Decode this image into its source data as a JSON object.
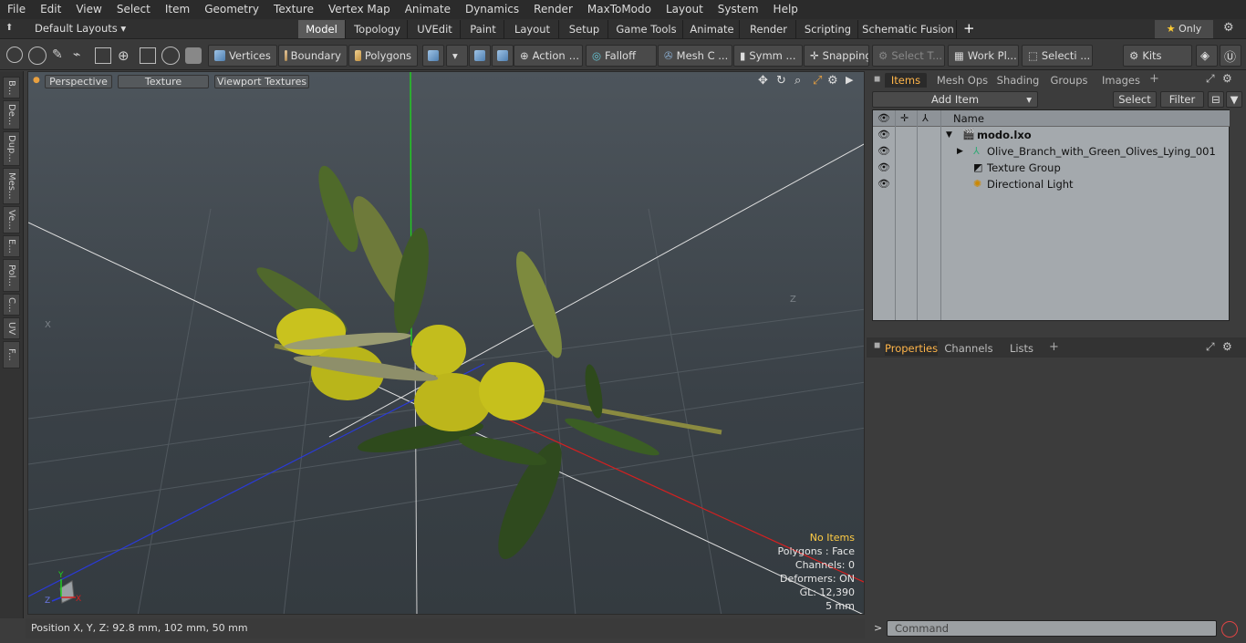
{
  "menu": [
    "File",
    "Edit",
    "View",
    "Select",
    "Item",
    "Geometry",
    "Texture",
    "Vertex Map",
    "Animate",
    "Dynamics",
    "Render",
    "MaxToModo",
    "Layout",
    "System",
    "Help"
  ],
  "layouts": {
    "label": "Default Layouts",
    "tabs": [
      "Model",
      "Topology",
      "UVEdit",
      "Paint",
      "Layout",
      "Setup",
      "Game Tools",
      "Animate",
      "Render",
      "Scripting",
      "Schematic Fusion"
    ],
    "active": "Model",
    "only_label": "Only"
  },
  "toolbar": {
    "vertices": "Vertices",
    "boundary": "Boundary",
    "polygons": "Polygons",
    "action": "Action",
    "falloff": "Falloff",
    "mesh": "Mesh C ...",
    "symm": "Symm ...",
    "snapping": "Snapping",
    "select_t": "Select T...",
    "workpl": "Work Pl...",
    "selecti": "Selecti ...",
    "kits": "Kits"
  },
  "lefttabs": [
    "B...",
    "De...",
    "Dup...",
    "Mes...",
    "Ve...",
    "E...",
    "Pol...",
    "C...",
    "UV",
    "F..."
  ],
  "viewport": {
    "perspective": "Perspective",
    "texture": "Texture",
    "viewport_textures": "Viewport Textures",
    "hud": {
      "no_items": "No Items",
      "polygons": "Polygons : Face",
      "channels": "Channels: 0",
      "deformers": "Deformers: ON",
      "gl": "GL: 12,390",
      "scale": "5 mm"
    },
    "axis_x": "X",
    "axis_y": "Y",
    "axis_z": "Z"
  },
  "status": {
    "position": "Position X, Y, Z:  92.8 mm, 102 mm, 50 mm"
  },
  "items_panel": {
    "tabs": [
      "Items",
      "Mesh Ops",
      "Shading",
      "Groups",
      "Images"
    ],
    "active": "Items",
    "add_item": "Add Item",
    "select": "Select",
    "filter": "Filter",
    "name_header": "Name",
    "rows": [
      {
        "label": "modo.lxo"
      },
      {
        "label": "Olive_Branch_with_Green_Olives_Lying_001"
      },
      {
        "label": "Texture Group"
      },
      {
        "label": "Directional Light"
      }
    ]
  },
  "properties_panel": {
    "tabs": [
      "Properties",
      "Channels",
      "Lists"
    ],
    "active": "Properties"
  },
  "command": {
    "placeholder": "Command",
    "prompt": ">"
  },
  "colors": {
    "accent": "#ffb54a",
    "x_axis": "#d42020",
    "y_axis": "#20d020",
    "z_axis": "#2040d0"
  }
}
